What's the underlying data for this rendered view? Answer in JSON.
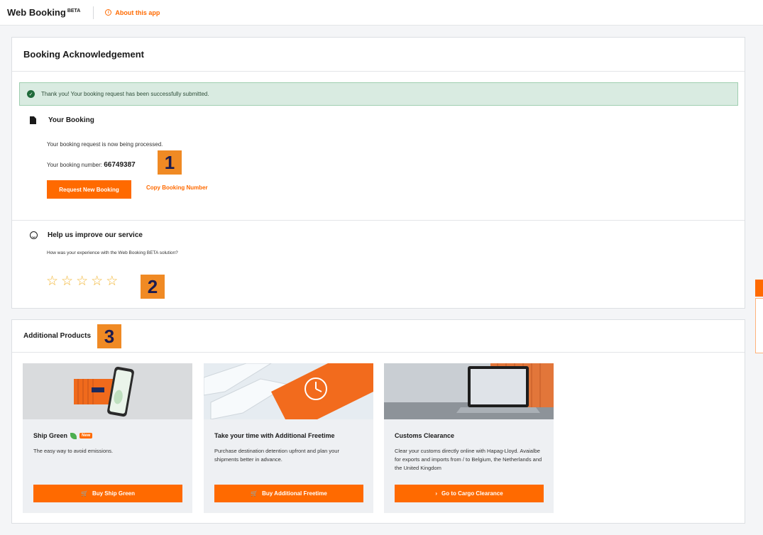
{
  "header": {
    "app_title": "Web Booking",
    "badge": "BETA",
    "about_label": "About this app",
    "about_icon": "info-icon"
  },
  "acknowledgement": {
    "title": "Booking Acknowledgement",
    "success_message": "Thank you! Your booking request has been successfully submitted.",
    "section_title": "Your Booking",
    "processing_text": "Your booking request is now being processed.",
    "booking_number_label": "Your booking number:",
    "booking_number": "66749387",
    "request_button": "Request New Booking",
    "copy_link": "Copy Booking Number"
  },
  "feedback": {
    "title": "Help us improve our service",
    "question": "How was your experience with the Web Booking BETA solution?",
    "rating_max": 5,
    "rating_value": 0,
    "star_glyph": "☆"
  },
  "markers": [
    "1",
    "2",
    "3"
  ],
  "products": {
    "title": "Additional Products",
    "items": [
      {
        "title": "Ship Green",
        "badge": "New",
        "description": "The easy way to avoid emissions.",
        "button": "Buy Ship Green",
        "button_icon": "cart-icon"
      },
      {
        "title": "Take your time with Additional Freetime",
        "description": "Purchase destination detention upfront and plan your shipments better in advance.",
        "button": "Buy Additional Freetime",
        "button_icon": "cart-icon"
      },
      {
        "title": "Customs Clearance",
        "description": "Clear your customs directly online with Hapag-Lloyd. Avaialbe for exports and imports from / to Belgium, the Netherlands and the United Kingdom",
        "button": "Go to Cargo Clearance",
        "button_icon": "chevron-right-icon"
      }
    ]
  },
  "colors": {
    "accent": "#ff6a00",
    "success_bg": "#d9ebe1",
    "marker": "#f08a24",
    "star": "#f2b431"
  }
}
